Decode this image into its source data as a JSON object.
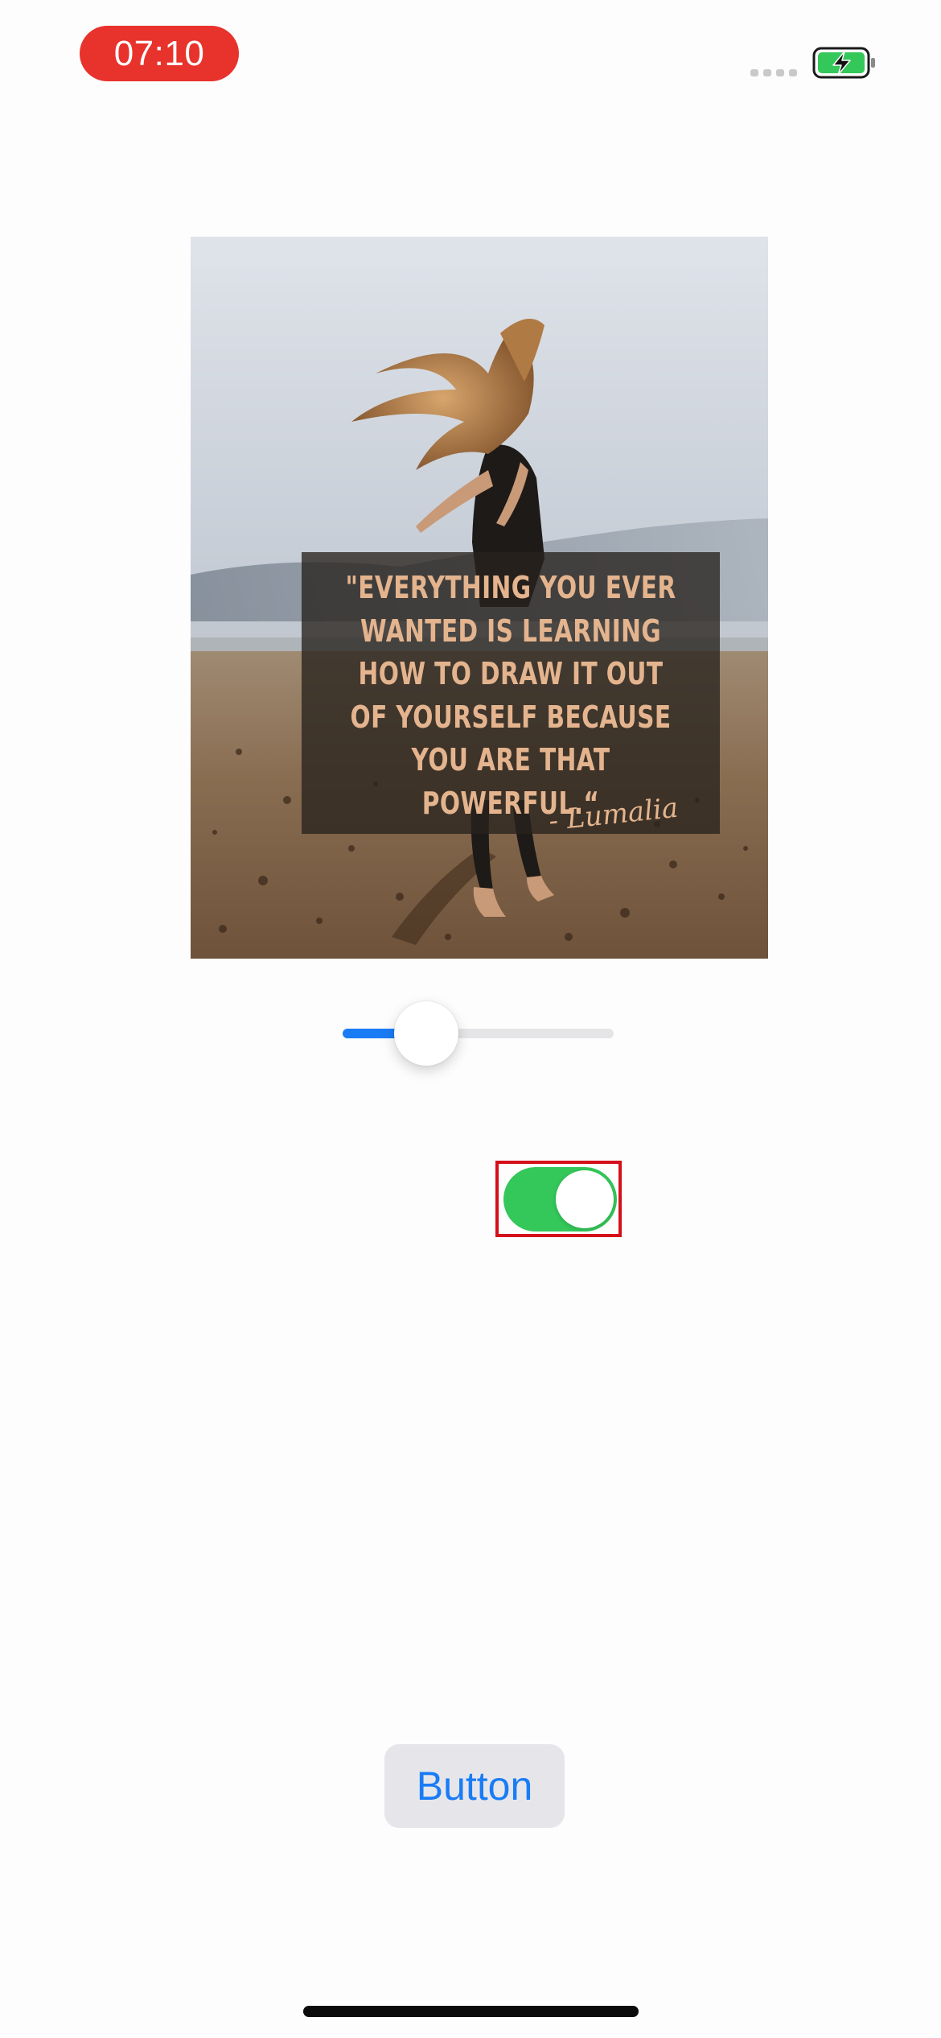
{
  "status_bar": {
    "time": "07:10",
    "time_pill_color": "#e8322c",
    "battery_icon": "battery-charging-icon",
    "battery_color": "#34c759",
    "signal_icon": "cellular-signal-icon"
  },
  "image": {
    "icon": "quote-photo-image",
    "quote_text": "\"EVERYTHING YOU EVER\nWANTED IS LEARNING\nHOW TO DRAW IT OUT\nOF YOURSELF BECAUSE\nYOU ARE THAT\nPOWERFUL.“",
    "signature": "- Lumalia"
  },
  "slider": {
    "value_fraction": 0.31,
    "accent_color": "#1a7cf5"
  },
  "switch": {
    "is_on": true,
    "on_color": "#34c759",
    "highlight_color": "#d4101b"
  },
  "button": {
    "label": "Button",
    "text_color": "#1a7cf5"
  }
}
